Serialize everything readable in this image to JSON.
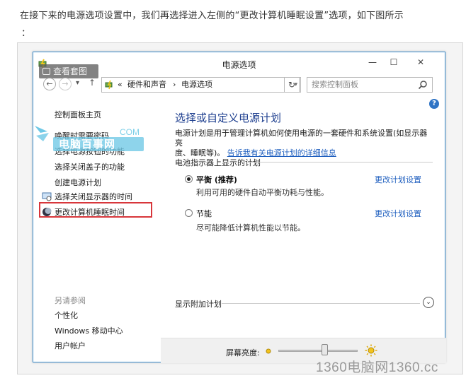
{
  "article": {
    "text": "在接下来的电源选项设置中，我们再选择进入左侧的“更改计算机睡眠设置”选项，如下图所示",
    "trailing_colon": "："
  },
  "window": {
    "title": "电源选项",
    "overlay_badge": "查看套图",
    "buttons": {
      "minimize": "—",
      "maximize": "☐",
      "close": "✕"
    }
  },
  "addressbar": {
    "back": "←",
    "forward": "→",
    "recent": "▾",
    "up": "↑",
    "crumbs_prefix": "«",
    "crumb_1": "硬件和声音",
    "crumb_sep": "›",
    "crumb_2": "电源选项",
    "dropdown": "▾",
    "refresh": "↻",
    "search_placeholder": "搜索控制面板"
  },
  "sidebar": {
    "home": "控制面板主页",
    "items": [
      "唤醒时需要密码",
      "选择电源按钮的功能",
      "选择关闭盖子的功能",
      "创建电源计划",
      "选择关闭显示器的时间",
      "更改计算机睡眠时间"
    ],
    "see_also_title": "另请参阅",
    "see_also": [
      "个性化",
      "Windows 移动中心",
      "用户帐户"
    ]
  },
  "watermark": {
    "text": "电脑百事网",
    "suffix": "COM",
    "site": "1360电脑网1360.cc"
  },
  "main": {
    "help": "?",
    "title": "选择或自定义电源计划",
    "desc_line1": "电源计划是用于管理计算机如何使用电源的一套硬件和系统设置(如显示器亮",
    "desc_line2": "度、睡眠等)。",
    "desc_link": "告诉我有关电源计划的详细信息",
    "group_label": "电池指示器上显示的计划",
    "plans": [
      {
        "name": "平衡 (推荐)",
        "desc": "利用可用的硬件自动平衡功耗与性能。",
        "link": "更改计划设置",
        "selected": true
      },
      {
        "name": "节能",
        "desc": "尽可能降低计算机性能以节能。",
        "link": "更改计划设置",
        "selected": false
      }
    ],
    "extra_label": "显示附加计划",
    "expand": "⌄"
  },
  "statusbar": {
    "brightness_label": "屏幕亮度:",
    "brightness_level": 0.58
  },
  "colors": {
    "accent_blue": "#1f5fbf",
    "title_blue": "#1e3f8f",
    "highlight_red": "#d8363b",
    "watermark_cyan": "#6ec8e6"
  }
}
